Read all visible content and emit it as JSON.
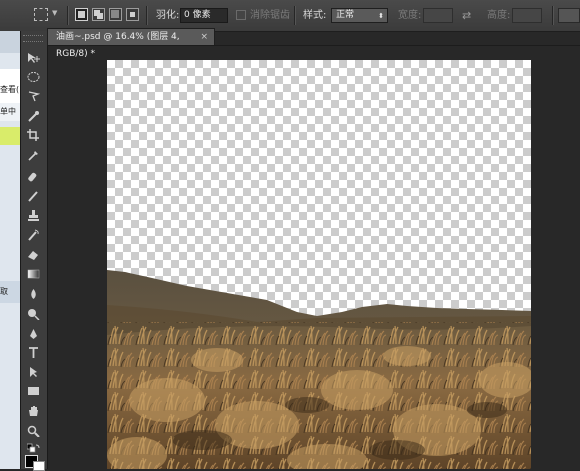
{
  "options_bar": {
    "feather_label": "羽化:",
    "feather_value": "0 像素",
    "antialias_label": "消除锯齿",
    "style_label": "样式:",
    "style_value": "正常",
    "width_label": "宽度:",
    "height_label": "高度:"
  },
  "document": {
    "tab_title": "油画~.psd @ 16.4% (图层 4, RGB/8) *",
    "close_glyph": "×"
  },
  "left_strip": {
    "fragments": [
      "查看(",
      "单中",
      "取"
    ]
  },
  "tools": [
    "move-tool",
    "marquee-tool",
    "lasso-tool",
    "quick-selection-tool",
    "crop-tool",
    "eyedropper-tool",
    "spot-healing-tool",
    "brush-tool",
    "clone-stamp-tool",
    "history-brush-tool",
    "eraser-tool",
    "gradient-tool",
    "blur-tool",
    "dodge-tool",
    "pen-tool",
    "type-tool",
    "path-selection-tool",
    "shape-tool",
    "hand-tool",
    "zoom-tool"
  ],
  "colors": {
    "foreground": "#000000",
    "background": "#ffffff",
    "ui_dark": "#282828"
  }
}
